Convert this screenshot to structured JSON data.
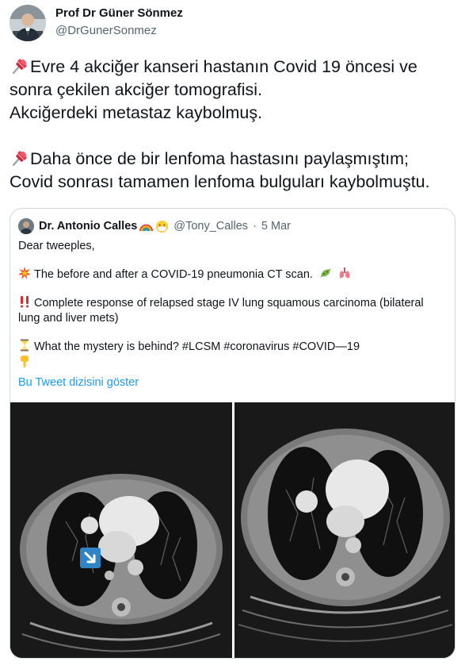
{
  "tweet": {
    "author_name": "Prof Dr Güner Sönmez",
    "author_handle": "@DrGunerSonmez",
    "line1": "Evre 4 akciğer kanseri hastanın Covid 19 öncesi ve",
    "line2": "sonra çekilen akciğer tomografisi.",
    "line3": "Akciğerdeki metastaz kaybolmuş.",
    "line4": "Daha önce de bir lenfoma hastasını paylaşmıştım;",
    "line5": "Covid sonrası tamamen lenfoma bulguları kaybolmuştu.",
    "pin_icon": "pushpin-icon"
  },
  "quoted_tweet": {
    "author_name": "Dr. Antonio Calles",
    "author_handle": "@Tony_Calles",
    "separator": "·",
    "date": "5 Mar",
    "greeting": "Dear tweeples,",
    "para1": "The before and after a COVID-19 pneumonia CT scan.",
    "para2": "Complete response of relapsed stage IV lung squamous carcinoma (bilateral lung and liver mets)",
    "para3": "What the mystery is behind? #LCSM #coronavirus #COVID—19",
    "show_thread_link": "Bu Tweet dizisini göster",
    "icons": [
      "rainbow-icon",
      "mask-face-icon",
      "collision-icon",
      "microbe-icon",
      "lungs-icon",
      "double-exclamation-icon",
      "hourglass-icon",
      "pointing-down-icon"
    ]
  },
  "images": {
    "left": "ct-scan-before",
    "right": "ct-scan-after"
  },
  "colors": {
    "text": "#0f1419",
    "secondary": "#536471",
    "link": "#1d9bf0",
    "border": "#cfd9de"
  }
}
